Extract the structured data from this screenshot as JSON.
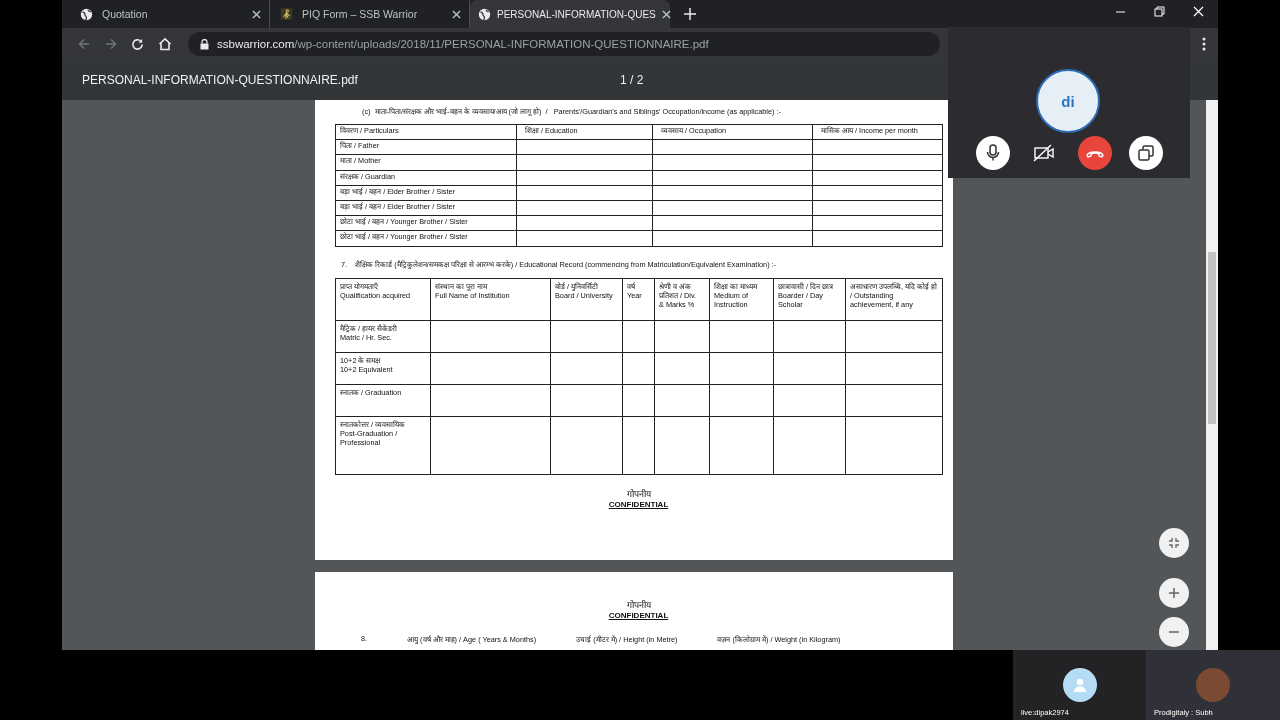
{
  "tabs": [
    {
      "title": "Quotation",
      "kind": "globe",
      "selected": false
    },
    {
      "title": "PIQ Form – SSB Warrior",
      "kind": "site",
      "selected": false
    },
    {
      "title": "PERSONAL-INFORMATION-QUES",
      "kind": "globe",
      "selected": true
    }
  ],
  "address_bar": {
    "domain": "ssbwarrior.com",
    "path": "/wp-content/uploads/2018/11/PERSONAL-INFORMATION-QUESTIONNAIRE.pdf"
  },
  "pdf_toolbar": {
    "file_name": "PERSONAL-INFORMATION-QUESTIONNAIRE.pdf",
    "page_indicator": "1 / 2"
  },
  "page_1": {
    "section_c": {
      "heading": "(c)  माता-पिता/संरक्षक और भाई-बहन के व्यवसाय/आय (जो लागू हो)  /   Parents'/Guardian's and Siblings' Occupation/income (as applicable) :-",
      "columns": [
        "विवरण / Particulars",
        "शिक्षा / Education",
        "व्यवसाय / Occupation",
        "मासिक आय / Income per month"
      ],
      "rows": [
        "पिता / Father",
        "माता / Mother",
        "संरक्षक / Guardian",
        "बड़ा भाई / बहन / Elder Brother / Sister",
        "बड़ा भाई / बहन / Elder Brother / Sister",
        "छोटा भाई / बहन / Younger Brother / Sister",
        "छोटा भाई / बहन / Younger Brother / Sister"
      ]
    },
    "section_7": {
      "heading": "7.    शैक्षिक रिकार्ड (मैट्रिकुलेशन/समकक्ष परिक्षा से आरम्भ करके) / Educational Record (commencing from Matriculation/Equivalent Examination) :-",
      "columns": [
        {
          "hindi": "प्राप्त योगयताऍं",
          "english": "Qualification acquired"
        },
        {
          "hindi": "संस्थान का पूरा नाम",
          "english": "Full Name of Institution"
        },
        {
          "hindi": "बोर्ड / युनिवर्सिटी",
          "english": "Board / University"
        },
        {
          "hindi": "वर्ष",
          "english": "Year"
        },
        {
          "hindi": "श्रेणी व अंक प्रतिशत / Div.",
          "english": "& Marks %"
        },
        {
          "hindi": "शिक्षा का माध्यम",
          "english": "Medium of Instruction"
        },
        {
          "hindi": "छात्रावासी / दिन छात्र",
          "english": "Boarder / Day Scholar"
        },
        {
          "hindi": "असाधारण उपलब्धि, यदि कोई हो / Outstanding",
          "english": "achievement, if any"
        }
      ],
      "rows": [
        {
          "hindi": "मैट्रिक / हायर सैकेंडरी",
          "english": "Matric / Hr. Sec."
        },
        {
          "hindi": "10+2 के समक्ष",
          "english": "10+2 Equivalent"
        },
        {
          "hindi": "स्नातक / Graduation",
          "english": ""
        },
        {
          "hindi": "स्नातकोत्तर / व्यवसायिक",
          "english": "Post-Graduation / Professional"
        }
      ]
    },
    "footer": {
      "hindi": "गोपनीय",
      "english": "CONFIDENTIAL"
    }
  },
  "page_2": {
    "header": {
      "hindi": "गोपनीय",
      "english": "CONFIDENTIAL"
    },
    "fields": [
      "8.",
      "आयु (वर्ष और माह) / Age ( Years & Months)",
      "उचाई (मीटर में) / Height (in Metre)",
      "वज़न (किलोग्राम में) / Weight (in Kilogram)"
    ]
  },
  "call_panel": {
    "avatar_initials": "di",
    "controls": [
      {
        "kind": "mic"
      },
      {
        "kind": "camera_off"
      },
      {
        "kind": "hang_up"
      },
      {
        "kind": "popout"
      }
    ]
  },
  "participants": [
    {
      "name": "live:dipak2974",
      "kind": "default_avatar"
    },
    {
      "name": "Prodigitaly : Subh",
      "kind": "photo"
    }
  ]
}
